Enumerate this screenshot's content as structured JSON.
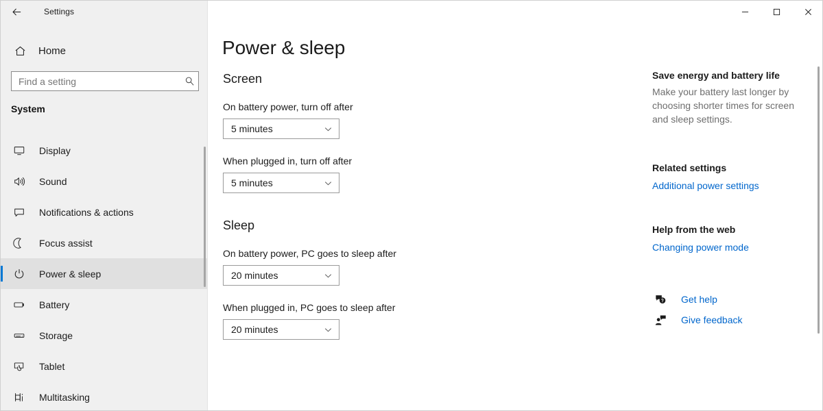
{
  "window": {
    "title": "Settings",
    "back_icon": "back-arrow-icon",
    "minimize_label": "—",
    "maximize_label": "□",
    "close_label": "✕"
  },
  "nav": {
    "home_label": "Home",
    "home_icon": "home-icon",
    "search": {
      "placeholder": "Find a setting",
      "value": "",
      "icon": "search-icon"
    },
    "section_label": "System",
    "items": [
      {
        "label": "Display",
        "icon": "monitor-icon",
        "selected": false
      },
      {
        "label": "Sound",
        "icon": "speaker-icon",
        "selected": false
      },
      {
        "label": "Notifications & actions",
        "icon": "notification-icon",
        "selected": false
      },
      {
        "label": "Focus assist",
        "icon": "moon-icon",
        "selected": false
      },
      {
        "label": "Power & sleep",
        "icon": "power-icon",
        "selected": true
      },
      {
        "label": "Battery",
        "icon": "battery-icon",
        "selected": false
      },
      {
        "label": "Storage",
        "icon": "storage-icon",
        "selected": false
      },
      {
        "label": "Tablet",
        "icon": "tablet-icon",
        "selected": false
      },
      {
        "label": "Multitasking",
        "icon": "multitasking-icon",
        "selected": false
      }
    ]
  },
  "main": {
    "page_title": "Power & sleep",
    "screen": {
      "heading": "Screen",
      "fields": [
        {
          "label": "On battery power, turn off after",
          "value": "5 minutes"
        },
        {
          "label": "When plugged in, turn off after",
          "value": "5 minutes"
        }
      ]
    },
    "sleep": {
      "heading": "Sleep",
      "fields": [
        {
          "label": "On battery power, PC goes to sleep after",
          "value": "20 minutes"
        },
        {
          "label": "When plugged in, PC goes to sleep after",
          "value": "20 minutes"
        }
      ]
    }
  },
  "info": {
    "save_energy": {
      "heading": "Save energy and battery life",
      "body": "Make your battery last longer by choosing shorter times for screen and sleep settings."
    },
    "related": {
      "heading": "Related settings",
      "link": "Additional power settings"
    },
    "help_web": {
      "heading": "Help from the web",
      "link": "Changing power mode"
    },
    "support": [
      {
        "label": "Get help",
        "icon": "question-bubble-icon"
      },
      {
        "label": "Give feedback",
        "icon": "feedback-person-icon"
      }
    ]
  },
  "colors": {
    "accent": "#0078d4",
    "link": "#0066cc",
    "nav_background": "#f0f0f0",
    "content_background": "#ffffff",
    "muted_text": "#6e6e6e"
  }
}
